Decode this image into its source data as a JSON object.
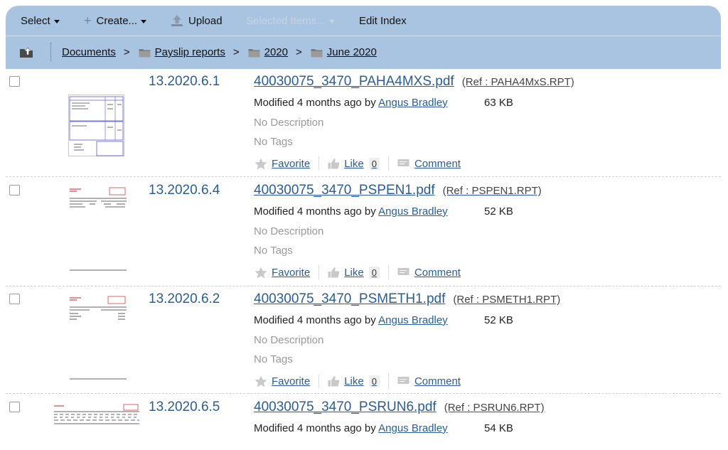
{
  "toolbar": {
    "select_label": "Select",
    "create_label": "Create...",
    "upload_label": "Upload",
    "selected_items_label": "Selected Items...",
    "edit_index_label": "Edit Index"
  },
  "breadcrumb": {
    "items": [
      "Documents",
      "Payslip reports",
      "2020",
      "June 2020"
    ],
    "separator": ">"
  },
  "actions": {
    "favorite": "Favorite",
    "like": "Like",
    "comment": "Comment"
  },
  "documents": [
    {
      "id": "13.2020.6.1",
      "filename": "40030075_3470_PAHA4MXS.pdf",
      "ref": "(Ref : PAHA4MxS.RPT)",
      "modified_prefix": "Modified 4 months ago by",
      "author": "Angus Bradley",
      "size": "63 KB",
      "description": "No Description",
      "tags": "No Tags",
      "likes": "0"
    },
    {
      "id": "13.2020.6.4",
      "filename": "40030075_3470_PSPEN1.pdf",
      "ref": "(Ref : PSPEN1.RPT)",
      "modified_prefix": "Modified 4 months ago by",
      "author": "Angus Bradley",
      "size": "52 KB",
      "description": "No Description",
      "tags": "No Tags",
      "likes": "0"
    },
    {
      "id": "13.2020.6.2",
      "filename": "40030075_3470_PSMETH1.pdf",
      "ref": "(Ref : PSMETH1.RPT)",
      "modified_prefix": "Modified 4 months ago by",
      "author": "Angus Bradley",
      "size": "52 KB",
      "description": "No Description",
      "tags": "No Tags",
      "likes": "0"
    },
    {
      "id": "13.2020.6.5",
      "filename": "40030075_3470_PSRUN6.pdf",
      "ref": "(Ref : PSRUN6.RPT)",
      "modified_prefix": "Modified 4 months ago by",
      "author": "Angus Bradley",
      "size": "54 KB"
    }
  ],
  "colors": {
    "toolbar_bg": "#a9c4e1",
    "link": "#2a5d95",
    "muted_text": "#9a9a9a"
  }
}
